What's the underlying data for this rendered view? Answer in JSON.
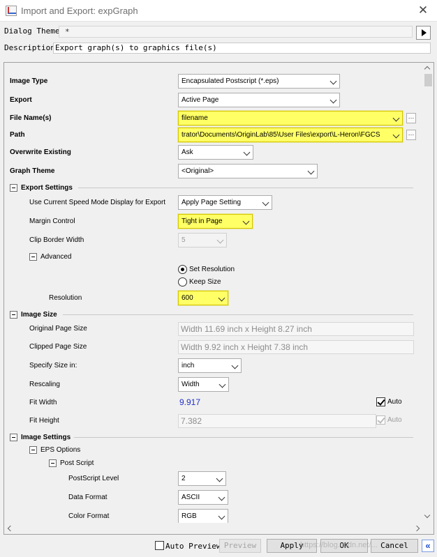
{
  "window": {
    "title": "Import and Export: expGraph",
    "close_label": "✕"
  },
  "dialog_theme": {
    "label": "Dialog Theme",
    "value": "*"
  },
  "description": {
    "label": "Description",
    "value": "Export graph(s) to graphics file(s)"
  },
  "fields": {
    "image_type": {
      "label": "Image Type",
      "value": "Encapsulated Postscript (*.eps)"
    },
    "export": {
      "label": "Export",
      "value": "Active Page"
    },
    "file_name": {
      "label": "File Name(s)",
      "value": "filename"
    },
    "path": {
      "label": "Path",
      "value": "trator\\Documents\\OriginLab\\85\\User Files\\export\\L-Heron\\FGCS"
    },
    "overwrite": {
      "label": "Overwrite Existing",
      "value": "Ask"
    },
    "graph_theme": {
      "label": "Graph Theme",
      "value": "<Original>"
    }
  },
  "export_settings": {
    "header": "Export Settings",
    "speed_mode": {
      "label": "Use Current Speed Mode Display for Export",
      "value": "Apply Page Setting"
    },
    "margin_control": {
      "label": "Margin Control",
      "value": "Tight in Page"
    },
    "clip_border": {
      "label": "Clip Border Width",
      "value": "5"
    },
    "advanced": {
      "header": "Advanced",
      "set_resolution": "Set Resolution",
      "keep_size": "Keep Size",
      "resolution": {
        "label": "Resolution",
        "value": "600"
      }
    }
  },
  "image_size": {
    "header": "Image Size",
    "original_page_size": {
      "label": "Original Page Size",
      "value": "Width 11.69 inch x Height 8.27 inch"
    },
    "clipped_page_size": {
      "label": "Clipped Page Size",
      "value": "Width 9.92 inch x Height 7.38 inch"
    },
    "specify_size_in": {
      "label": "Specify Size in:",
      "value": "inch"
    },
    "rescaling": {
      "label": "Rescaling",
      "value": "Width"
    },
    "fit_width": {
      "label": "Fit Width",
      "value": "9.917",
      "auto_label": "Auto",
      "auto_checked": true
    },
    "fit_height": {
      "label": "Fit Height",
      "value": "7.382",
      "auto_label": "Auto",
      "auto_checked": true
    }
  },
  "image_settings": {
    "header": "Image Settings",
    "eps_options": "EPS Options",
    "post_script": "Post Script",
    "postscript_level": {
      "label": "PostScript Level",
      "value": "2"
    },
    "data_format": {
      "label": "Data Format",
      "value": "ASCII"
    },
    "color_format": {
      "label": "Color Format",
      "value": "RGB"
    }
  },
  "bottom": {
    "auto_preview": "Auto Preview",
    "preview": "Preview",
    "apply": "Apply",
    "ok": "OK",
    "cancel": "Cancel",
    "collapse": "«",
    "watermark": "https://blog.csdn.net/..."
  },
  "colors": {
    "highlight": "#ffff66",
    "link_blue": "#1f2ecc"
  }
}
